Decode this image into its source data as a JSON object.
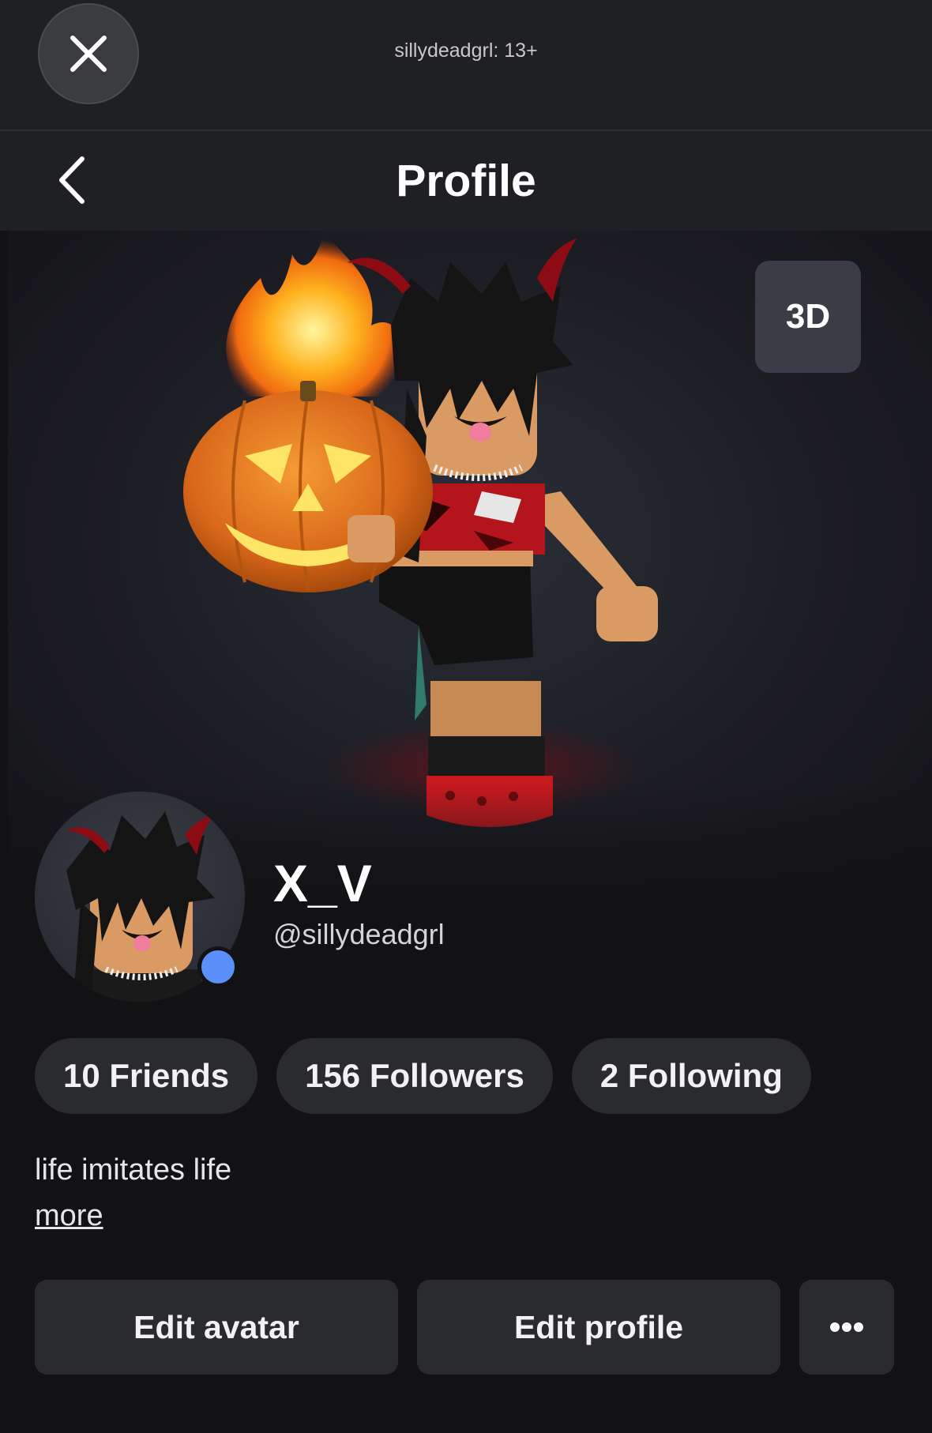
{
  "topbar": {
    "caption": "sillydeadgrl: 13+",
    "close_icon": "close-icon"
  },
  "nav": {
    "title": "Profile",
    "back_icon": "chevron-left-icon"
  },
  "hero": {
    "view_toggle_label": "3D"
  },
  "profile": {
    "display_name": "X_V",
    "username": "@sillydeadgrl",
    "online_status_color": "#5b8ff9"
  },
  "stats": [
    {
      "label": "10 Friends"
    },
    {
      "label": "156 Followers"
    },
    {
      "label": "2 Following"
    }
  ],
  "bio": {
    "text": "life imitates life",
    "more_label": "more"
  },
  "actions": {
    "edit_avatar": "Edit avatar",
    "edit_profile": "Edit profile",
    "more_icon": "ellipsis-icon"
  },
  "colors": {
    "background": "#121215",
    "bar": "#1f2023",
    "pill": "#2a2b2f",
    "accent_blue": "#5b8ff9"
  }
}
